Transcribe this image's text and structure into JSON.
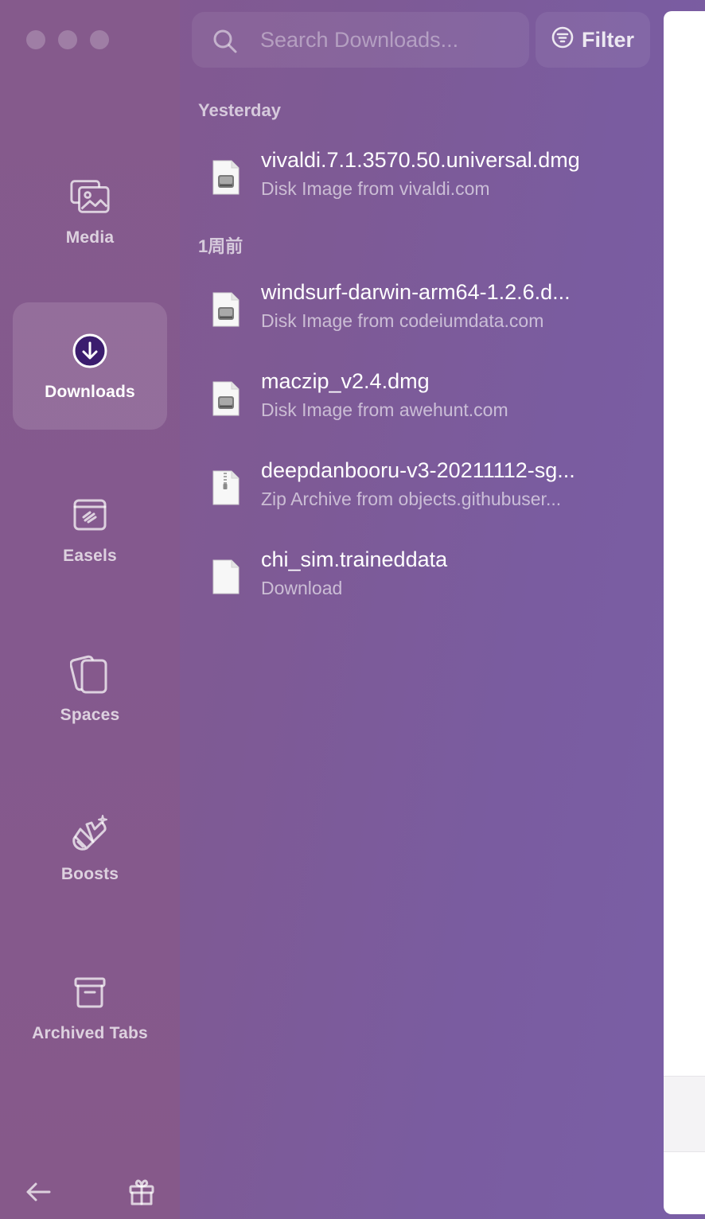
{
  "sidebar": {
    "items": [
      {
        "id": "media",
        "label": "Media",
        "icon": "photo-stack-icon"
      },
      {
        "id": "downloads",
        "label": "Downloads",
        "icon": "download-circle-icon",
        "active": true
      },
      {
        "id": "easels",
        "label": "Easels",
        "icon": "easel-icon"
      },
      {
        "id": "spaces",
        "label": "Spaces",
        "icon": "cards-icon"
      },
      {
        "id": "boosts",
        "label": "Boosts",
        "icon": "paintbrush-sparkle-icon"
      },
      {
        "id": "archived",
        "label": "Archived Tabs",
        "icon": "archive-box-icon"
      }
    ],
    "bottom": {
      "back_icon": "arrow-left-icon",
      "gift_icon": "gift-icon"
    }
  },
  "search": {
    "placeholder": "Search Downloads..."
  },
  "filter": {
    "label": "Filter"
  },
  "sections": [
    {
      "header": "Yesterday",
      "items": [
        {
          "name": "vivaldi.7.1.3570.50.universal.dmg",
          "sub": "Disk Image from vivaldi.com",
          "icon": "disk-image-icon"
        }
      ]
    },
    {
      "header": "1周前",
      "items": [
        {
          "name": "windsurf-darwin-arm64-1.2.6.d...",
          "sub": "Disk Image from codeiumdata.com",
          "icon": "disk-image-icon"
        },
        {
          "name": "maczip_v2.4.dmg",
          "sub": "Disk Image from awehunt.com",
          "icon": "disk-image-icon"
        },
        {
          "name": "deepdanbooru-v3-20211112-sg...",
          "sub": "Zip Archive from objects.githubuser...",
          "icon": "zip-archive-icon"
        },
        {
          "name": "chi_sim.traineddata",
          "sub": "Download",
          "icon": "document-icon"
        }
      ]
    }
  ],
  "colors": {
    "accent": "#3b1d6e",
    "window_bg": "#7b5c9e",
    "sidebar_bg": "#85598c"
  }
}
